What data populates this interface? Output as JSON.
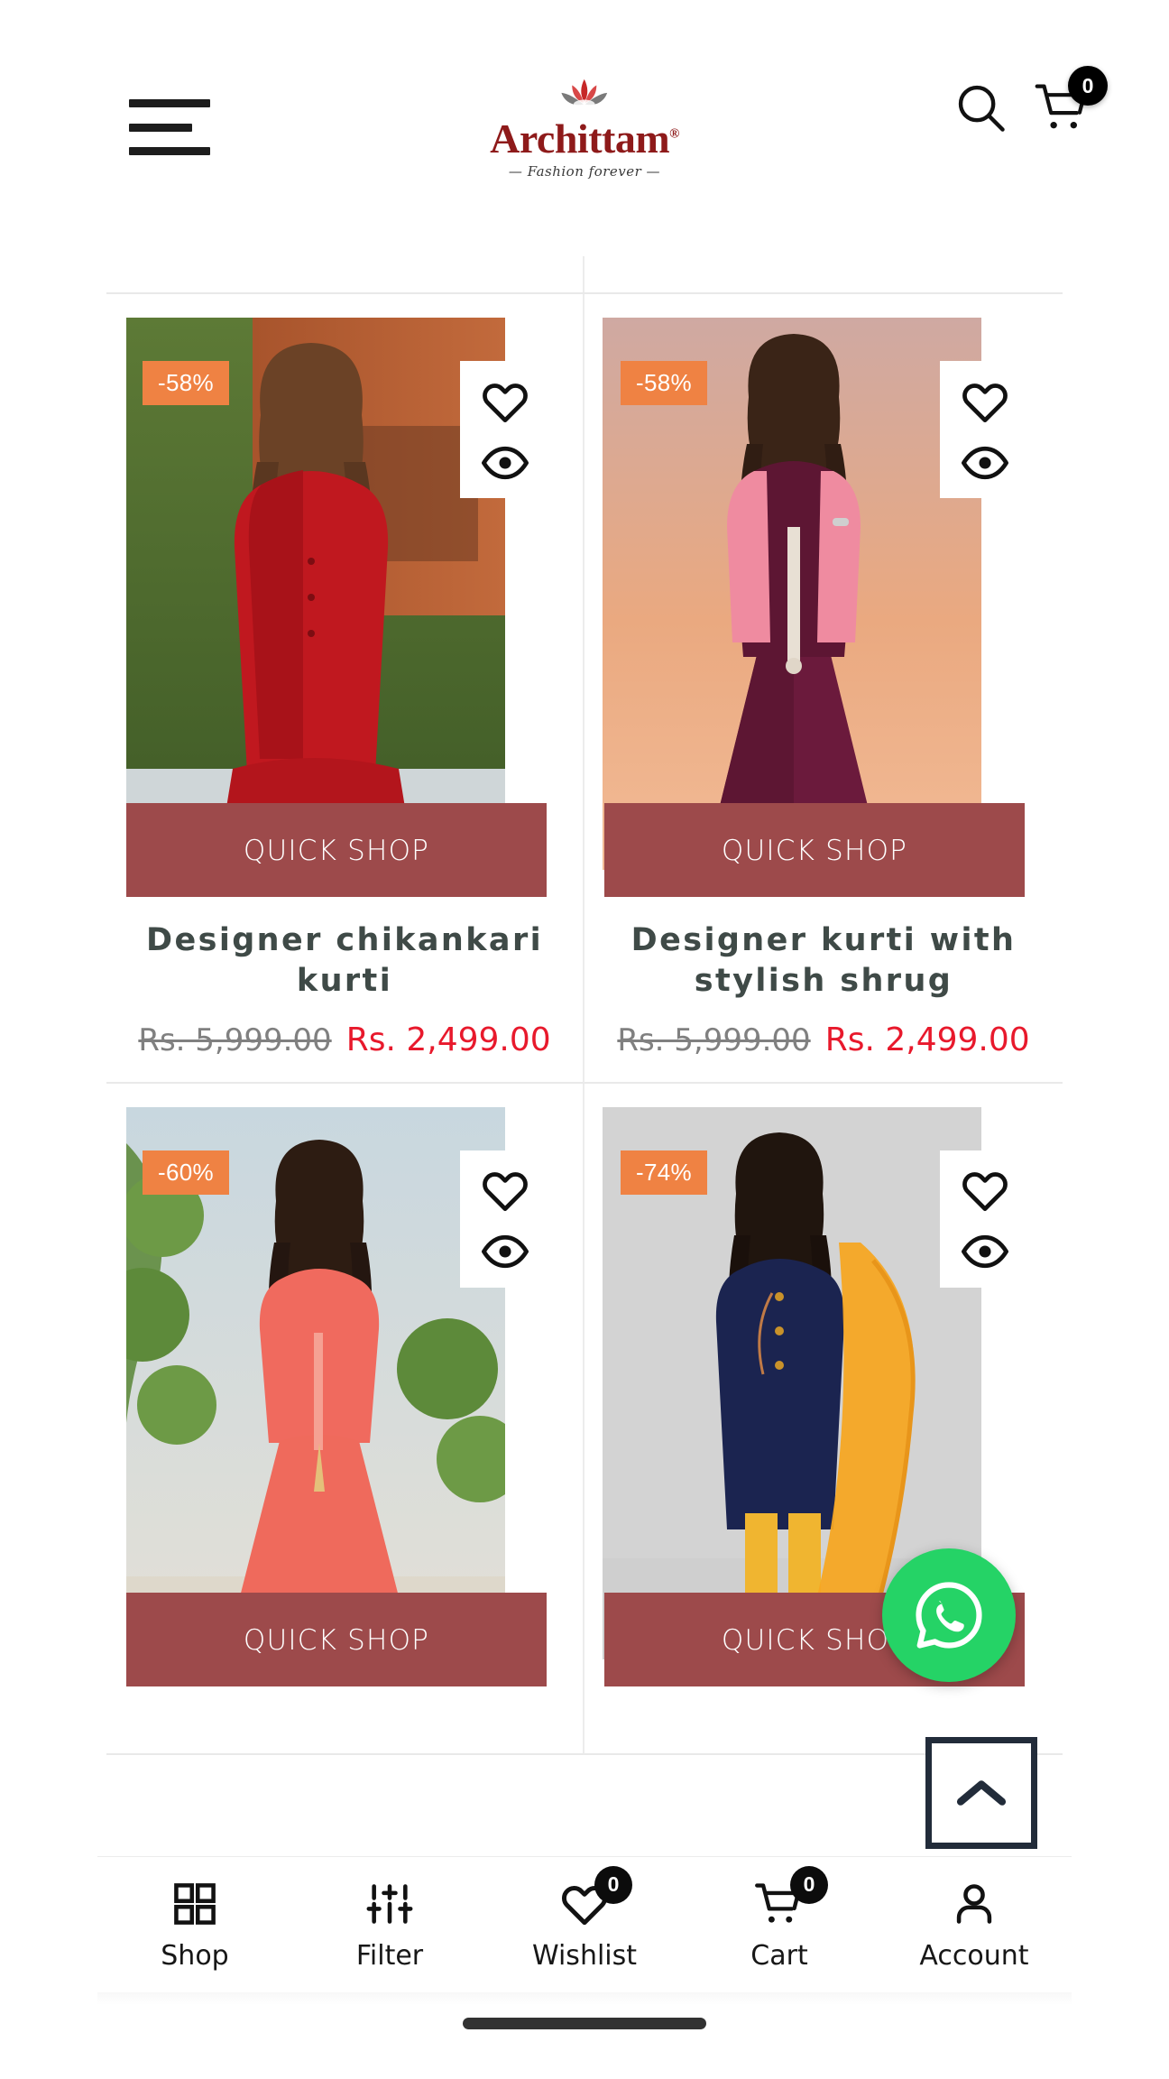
{
  "header": {
    "menu_icon": "hamburger-icon",
    "brand_name": "Archittam",
    "brand_trademark": "®",
    "brand_tagline": "— Fashion forever —",
    "search_icon": "search-icon",
    "cart_icon": "cart-icon",
    "cart_badge": "0",
    "brand_color": "#8e1a1a",
    "lotus_red": "#c62828"
  },
  "grid": {
    "quick_shop_label": "QUICK SHOP",
    "quick_shop_color": "#9d4a4b",
    "discount_badge_color": "#ef8243",
    "wishlist_icon": "heart-icon",
    "quickview_icon": "eye-icon",
    "title_color": "#3f4a47",
    "sale_price_color": "#e8192c",
    "products": [
      {
        "discount": "-58%",
        "title": "Designer chikankari kurti",
        "price_original": "Rs. 5,999.00",
        "price_sale": "Rs. 2,499.00"
      },
      {
        "discount": "-58%",
        "title": "Designer kurti with stylish shrug",
        "price_original": "Rs. 5,999.00",
        "price_sale": "Rs. 2,499.00"
      },
      {
        "discount": "-60%",
        "title": "",
        "price_original": "",
        "price_sale": ""
      },
      {
        "discount": "-74%",
        "title": "",
        "price_original": "",
        "price_sale": ""
      }
    ]
  },
  "floating": {
    "whatsapp_icon": "whatsapp-icon",
    "whatsapp_color": "#25d366",
    "scroll_top_icon": "chevron-up-icon",
    "scroll_top_border_color": "#222c3a"
  },
  "bottom_nav": {
    "items": [
      {
        "label": "Shop",
        "icon": "grid-icon",
        "badge": null
      },
      {
        "label": "Filter",
        "icon": "sliders-icon",
        "badge": null
      },
      {
        "label": "Wishlist",
        "icon": "heart-icon",
        "badge": "0"
      },
      {
        "label": "Cart",
        "icon": "cart-icon",
        "badge": "0"
      },
      {
        "label": "Account",
        "icon": "person-icon",
        "badge": null
      }
    ]
  }
}
